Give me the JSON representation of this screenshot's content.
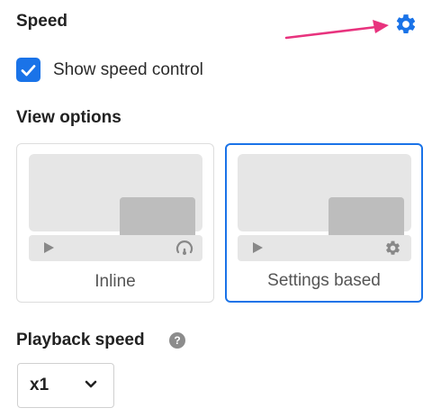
{
  "speed_section": {
    "title": "Speed"
  },
  "show_speed_control": {
    "label": "Show speed control",
    "checked": true
  },
  "view_options": {
    "title": "View options",
    "options": [
      {
        "label": "Inline",
        "selected": false,
        "bar_icon": "speed-gauge-icon"
      },
      {
        "label": "Settings based",
        "selected": true,
        "bar_icon": "gear-icon"
      }
    ]
  },
  "playback_speed": {
    "title": "Playback speed",
    "help": "?",
    "value": "x1"
  },
  "colors": {
    "accent": "#1a73e8",
    "arrow": "#e8337e",
    "card_border": "#dddddd",
    "preview": "#e6e6e6"
  }
}
